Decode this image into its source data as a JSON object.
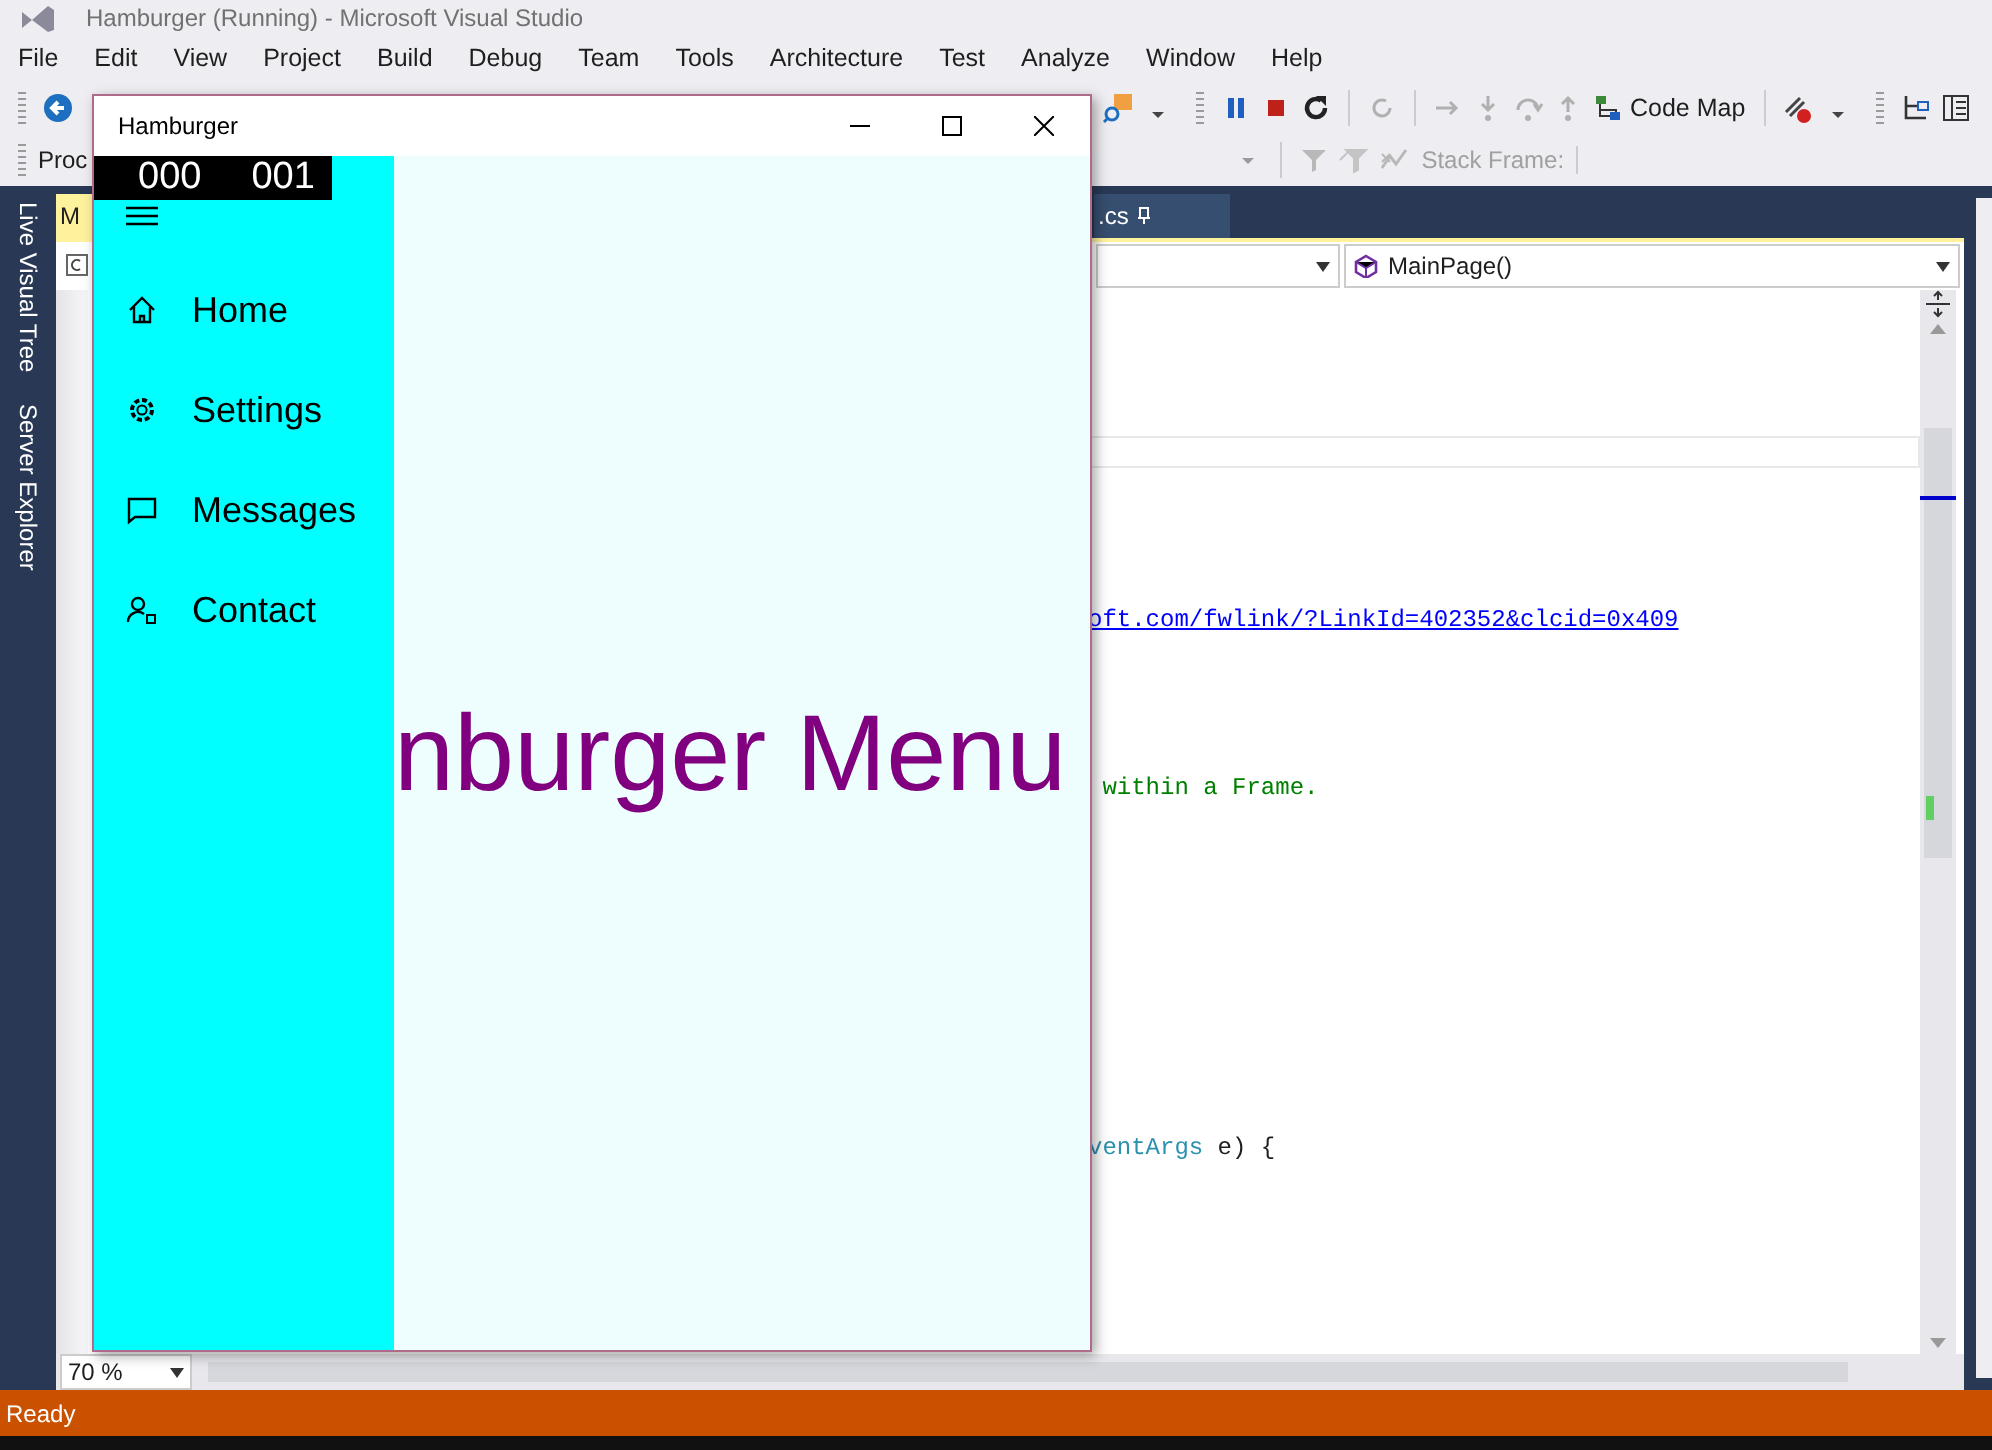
{
  "ide": {
    "title": "Hamburger (Running) - Microsoft Visual Studio",
    "menu": [
      "File",
      "Edit",
      "View",
      "Project",
      "Build",
      "Debug",
      "Team",
      "Tools",
      "Architecture",
      "Test",
      "Analyze",
      "Window",
      "Help"
    ],
    "toolbar": {
      "code_map": "Code Map"
    },
    "toolbar2": {
      "process_label": "Proc",
      "stack_frame": "Stack Frame:"
    },
    "side_tabs": [
      "Live Visual Tree",
      "Server Explorer"
    ],
    "doc_tabs": [
      {
        "label": "M",
        "selected": true
      },
      {
        "label": ".cs",
        "selected": false
      }
    ],
    "member_dropdown": "MainPage()",
    "code_lines": [
      {
        "tokens": [
          {
            "kind": "link",
            "text": "oft.com/fwlink/?LinkId=402352&clcid=0x409"
          }
        ]
      },
      {
        "tokens": [
          {
            "kind": "comment",
            "text": " within a Frame."
          }
        ]
      },
      {
        "tokens": [
          {
            "kind": "type",
            "text": "ventArgs"
          },
          {
            "kind": "plain",
            "text": " e) {"
          }
        ]
      }
    ],
    "zoom": "70 %",
    "status": "Ready"
  },
  "app": {
    "title": "Hamburger",
    "frame_counter": [
      "000",
      "001"
    ],
    "nav": [
      {
        "label": "Home"
      },
      {
        "label": "Settings"
      },
      {
        "label": "Messages"
      },
      {
        "label": "Contact"
      }
    ],
    "heading": "nburger Menu"
  }
}
